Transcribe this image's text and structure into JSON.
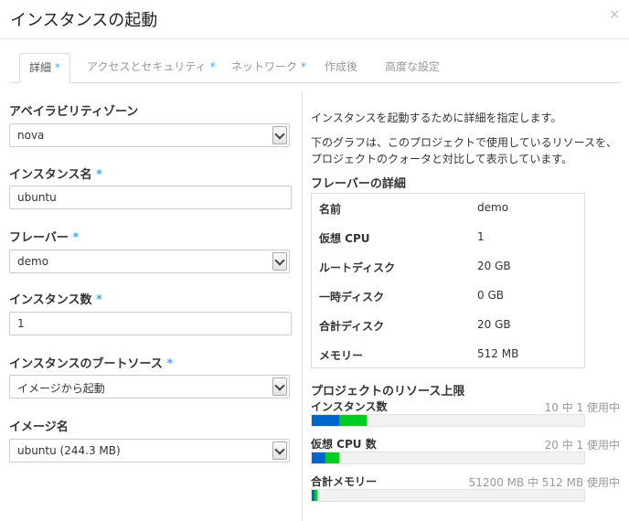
{
  "dialog": {
    "title": "インスタンスの起動",
    "close_glyph": "×"
  },
  "tabs": [
    {
      "label": "詳細",
      "required": true,
      "active": true
    },
    {
      "label": "アクセスとセキュリティ",
      "required": true,
      "active": false
    },
    {
      "label": "ネットワーク",
      "required": true,
      "active": false
    },
    {
      "label": "作成後",
      "required": false,
      "active": false
    },
    {
      "label": "高度な設定",
      "required": false,
      "active": false
    }
  ],
  "form": {
    "required_mark": "*",
    "availability_zone": {
      "label": "アベイラビリティゾーン",
      "value": "nova"
    },
    "instance_name": {
      "label": "インスタンス名",
      "value": "ubuntu"
    },
    "flavor": {
      "label": "フレーバー",
      "value": "demo"
    },
    "instance_count": {
      "label": "インスタンス数",
      "value": "1"
    },
    "boot_source": {
      "label": "インスタンスのブートソース",
      "value": "イメージから起動"
    },
    "image_name": {
      "label": "イメージ名",
      "value": "ubuntu (244.3 MB)"
    }
  },
  "info": {
    "desc1": "インスタンスを起動するために詳細を指定します。",
    "desc2": "下のグラフは、このプロジェクトで使用しているリソースを、プロジェクトのクォータと対比して表示しています。",
    "flavor_title": "フレーバーの詳細",
    "flavor_details": [
      {
        "key": "名前",
        "value": "demo"
      },
      {
        "key": "仮想 CPU",
        "value": "1"
      },
      {
        "key": "ルートディスク",
        "value": "20 GB"
      },
      {
        "key": "一時ディスク",
        "value": "0 GB"
      },
      {
        "key": "合計ディスク",
        "value": "20 GB"
      },
      {
        "key": "メモリー",
        "value": "512 MB"
      }
    ],
    "limits_title": "プロジェクトのリソース上限",
    "quotas": [
      {
        "label": "インスタンス数",
        "count_text": "10 中 1 使用中",
        "used_fraction": 0.1,
        "added_fraction": 0.1
      },
      {
        "label": "仮想 CPU 数",
        "count_text": "20 中 1 使用中",
        "used_fraction": 0.05,
        "added_fraction": 0.05
      },
      {
        "label": "合計メモリー",
        "count_text": "51200 MB 中 512 MB 使用中",
        "used_fraction": 0.01,
        "added_fraction": 0.01
      }
    ]
  },
  "colors": {
    "used": "#0066cc",
    "added": "#00cc22",
    "accent": "#4da6ff"
  }
}
